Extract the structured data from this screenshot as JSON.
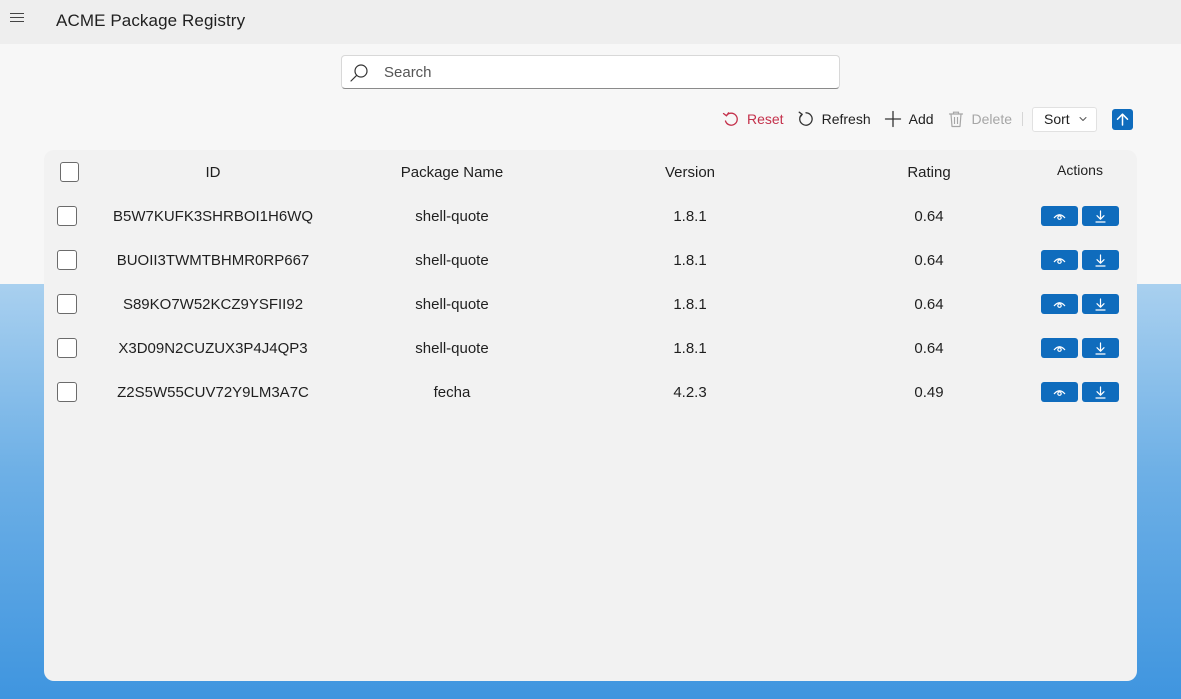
{
  "app": {
    "title": "ACME Package Registry"
  },
  "search": {
    "placeholder": "Search",
    "value": ""
  },
  "toolbar": {
    "reset_label": "Reset",
    "refresh_label": "Refresh",
    "add_label": "Add",
    "delete_label": "Delete",
    "sort_label": "Sort",
    "sort_direction": "ascending"
  },
  "table": {
    "columns": [
      "ID",
      "Package Name",
      "Version",
      "Rating",
      "Actions"
    ],
    "rows": [
      {
        "id": "B5W7KUFK3SHRBOI1H6WQ",
        "name": "shell-quote",
        "version": "1.8.1",
        "rating": "0.64"
      },
      {
        "id": "BUOII3TWMTBHMR0RP667",
        "name": "shell-quote",
        "version": "1.8.1",
        "rating": "0.64"
      },
      {
        "id": "S89KO7W52KCZ9YSFII92",
        "name": "shell-quote",
        "version": "1.8.1",
        "rating": "0.64"
      },
      {
        "id": "X3D09N2CUZUX3P4J4QP3",
        "name": "shell-quote",
        "version": "1.8.1",
        "rating": "0.64"
      },
      {
        "id": "Z2S5W55CUV72Y9LM3A7C",
        "name": "fecha",
        "version": "4.2.3",
        "rating": "0.49"
      }
    ]
  },
  "colors": {
    "accent": "#0f6cbd",
    "reset": "#c4314b",
    "disabled": "#a6a6a6",
    "card": "#f2f2f2"
  },
  "icons": {
    "menu": "hamburger-icon",
    "search": "search-icon",
    "reset": "undo-icon",
    "refresh": "refresh-icon",
    "add": "plus-icon",
    "delete": "trash-icon",
    "sort": "chevron-down-icon",
    "sort_direction": "arrow-up-icon",
    "view": "eye-icon",
    "download": "download-icon"
  }
}
